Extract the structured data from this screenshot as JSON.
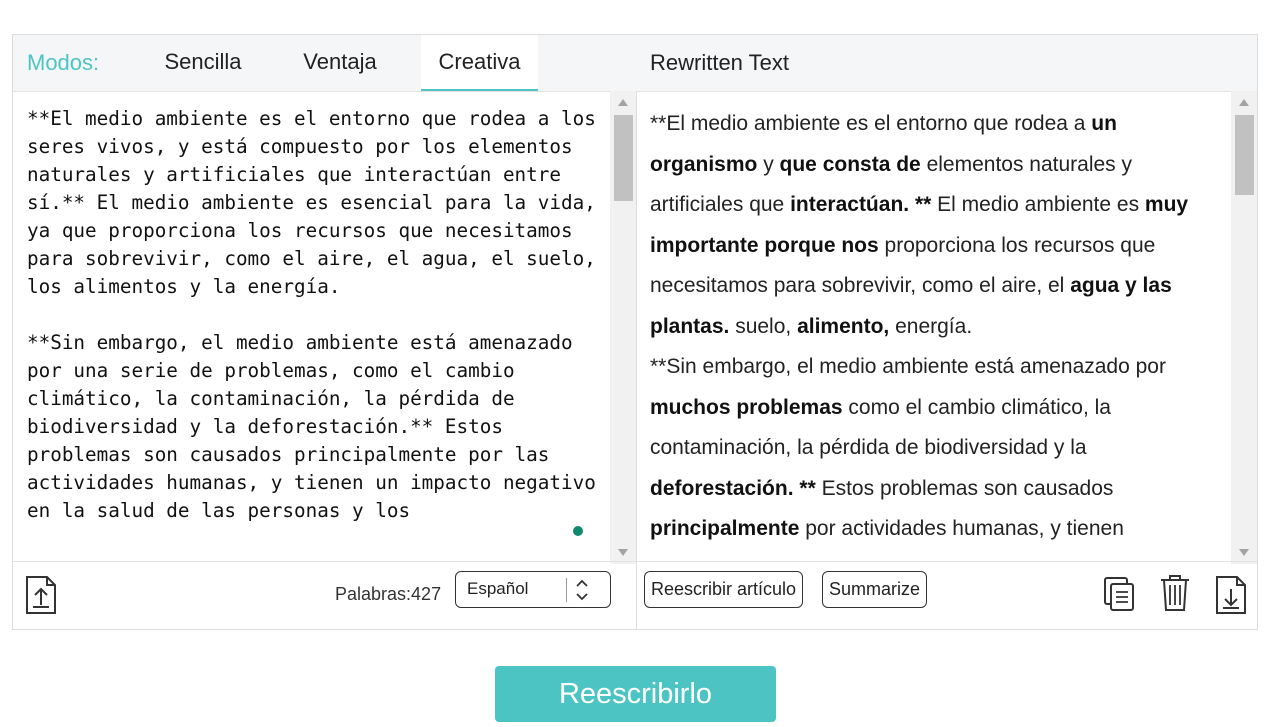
{
  "modes": {
    "label": "Modos:",
    "tabs": [
      {
        "label": "Sencilla",
        "active": false
      },
      {
        "label": "Ventaja",
        "active": false
      },
      {
        "label": "Creativa",
        "active": true
      }
    ]
  },
  "input": {
    "text": "**El medio ambiente es el entorno que rodea a los seres vivos, y está compuesto por los elementos naturales y artificiales que interactúan entre sí.** El medio ambiente es esencial para la vida, ya que proporciona los recursos que necesitamos para sobrevivir, como el aire, el agua, el suelo, los alimentos y la energía.\n\n**Sin embargo, el medio ambiente está amenazado por una serie de problemas, como el cambio climático, la contaminación, la pérdida de biodiversidad y la deforestación.** Estos problemas son causados principalmente por las actividades humanas, y tienen un impacto negativo en la salud de las personas y los"
  },
  "footer_left": {
    "word_count": "Palabras:427",
    "language": "Español"
  },
  "output": {
    "title": "Rewritten Text",
    "segments": [
      {
        "t": "**El medio ambiente es el entorno que rodea a ",
        "b": false
      },
      {
        "t": "un organismo",
        "b": true
      },
      {
        "t": " y ",
        "b": false
      },
      {
        "t": "que consta de",
        "b": true
      },
      {
        "t": " elementos naturales y artificiales que ",
        "b": false
      },
      {
        "t": "interactúan.",
        "b": true
      },
      {
        "t": " ",
        "b": false
      },
      {
        "t": "**",
        "b": true
      },
      {
        "t": " El medio ambiente es ",
        "b": false
      },
      {
        "t": "muy importante porque nos",
        "b": true
      },
      {
        "t": " proporciona los recursos que necesitamos para sobrevivir, como el aire, el ",
        "b": false
      },
      {
        "t": "agua y las plantas.",
        "b": true
      },
      {
        "t": " suelo, ",
        "b": false
      },
      {
        "t": "alimento,",
        "b": true
      },
      {
        "t": " energía.",
        "b": false
      },
      {
        "t": "\n **Sin embargo, el medio ambiente está amenazado por ",
        "b": false
      },
      {
        "t": "muchos problemas",
        "b": true
      },
      {
        "t": " como el cambio climático, la contaminación, la pérdida de biodiversidad y la ",
        "b": false
      },
      {
        "t": "deforestación.",
        "b": true
      },
      {
        "t": " ",
        "b": false
      },
      {
        "t": "**",
        "b": true
      },
      {
        "t": " Estos problemas son causados ",
        "b": false
      },
      {
        "t": "principalmente",
        "b": true
      },
      {
        "t": " por actividades humanas, y tienen",
        "b": false
      }
    ]
  },
  "footer_right": {
    "rewrite_article": "Reescribir artículo",
    "summarize": "Summarize"
  },
  "icons": [
    "upload-icon",
    "copy-icon",
    "trash-icon",
    "download-icon"
  ],
  "cta": "Reescribirlo",
  "colors": {
    "accent": "#4cc4c4",
    "dot": "#0f8a6e"
  }
}
